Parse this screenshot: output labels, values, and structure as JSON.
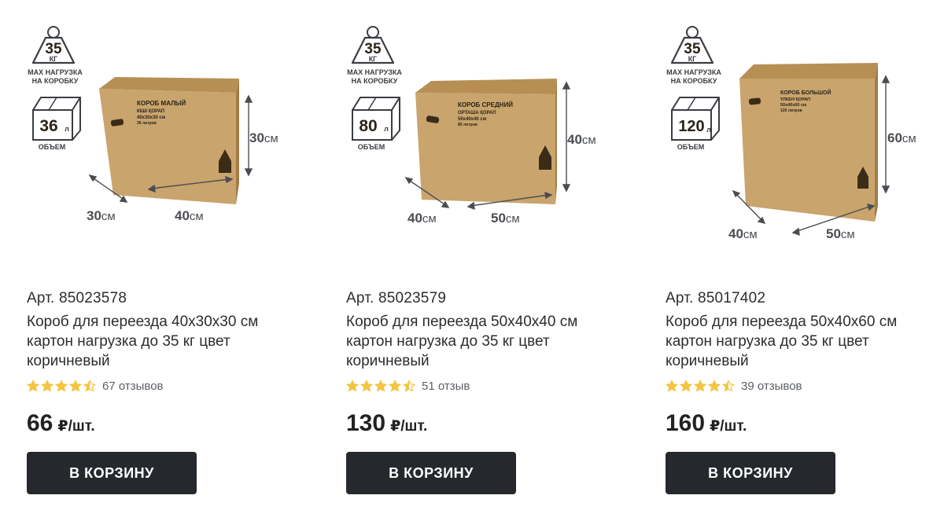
{
  "badge": {
    "weight_value": "35",
    "weight_unit": "КГ",
    "weight_caption_line1": "MAX НАГРУЗКА",
    "weight_caption_line2": "НА КОРОБКУ",
    "volume_caption": "ОБЪЕМ",
    "volume_unit": "л"
  },
  "dimension_unit": "см",
  "products": [
    {
      "volume": "36",
      "box_print": [
        "КОРОБ МАЛЫЙ",
        "КІШІ ҚОРАП",
        "40х30х30 см",
        "36 литров"
      ],
      "dims": {
        "depth": "30",
        "width": "40",
        "height": "30"
      },
      "article": "Арт. 85023578",
      "title": "Короб для переезда 40x30x30 см картон нагрузка до 35 кг цвет коричневый",
      "rating": 4.5,
      "reviews": "67 отзывов",
      "price": "66",
      "price_unit": "₽/шт.",
      "button_label": "В КОРЗИНУ"
    },
    {
      "volume": "80",
      "box_print": [
        "КОРОБ СРЕДНИЙ",
        "ОРТАША ҚОРАП",
        "50х40х40 см",
        "80 литров"
      ],
      "dims": {
        "depth": "40",
        "width": "50",
        "height": "40"
      },
      "article": "Арт. 85023579",
      "title": "Короб для переезда 50x40x40 см картон нагрузка до 35 кг цвет коричневый",
      "rating": 4.5,
      "reviews": "51 отзыв",
      "price": "130",
      "price_unit": "₽/шт.",
      "button_label": "В КОРЗИНУ"
    },
    {
      "volume": "120",
      "box_print": [
        "КОРОБ БОЛЬШОЙ",
        "ҮЛКЕН ҚОРАП",
        "50х40х60 см",
        "120 литров"
      ],
      "dims": {
        "depth": "40",
        "width": "50",
        "height": "60"
      },
      "article": "Арт. 85017402",
      "title": "Короб для переезда 50x40x60 см картон нагрузка до 35 кг цвет коричневый",
      "rating": 4.5,
      "reviews": "39 отзывов",
      "price": "160",
      "price_unit": "₽/шт.",
      "button_label": "В КОРЗИНУ"
    }
  ],
  "colors": {
    "button_bg": "#25282d",
    "star": "#f4c542",
    "star_empty": "#e3e3e3",
    "cardboard": "#c9a46d"
  }
}
